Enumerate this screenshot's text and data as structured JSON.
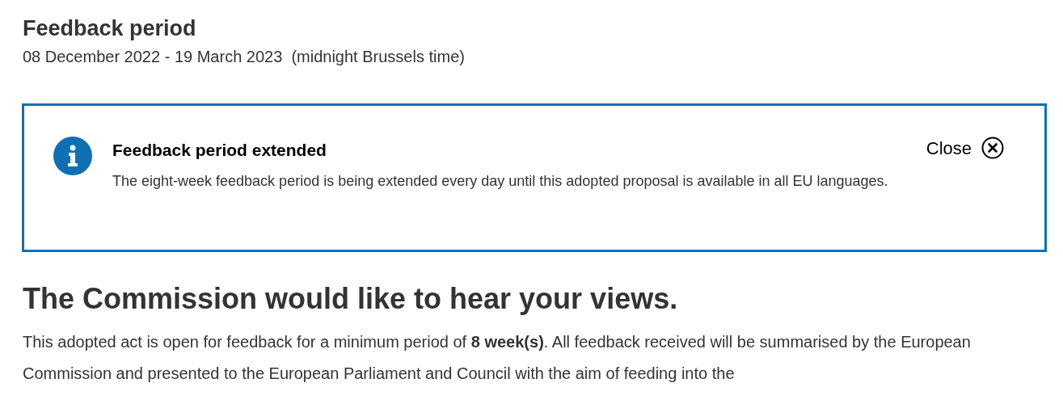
{
  "period": {
    "title": "Feedback period",
    "dates": "08 December 2022 - 19 March 2023  (midnight Brussels time)"
  },
  "notice": {
    "title": "Feedback period extended",
    "body": "The eight-week feedback period is being extended every day until this adopted proposal is available in all EU languages.",
    "close": "Close"
  },
  "section": {
    "heading": "The Commission would like to hear your views.",
    "paragraph": "This adopted act is open for feedback for a minimum period of **8 week(s)**. All feedback received will be summarised by the European Commission and presented to the European Parliament and Council with the aim of feeding into the"
  }
}
